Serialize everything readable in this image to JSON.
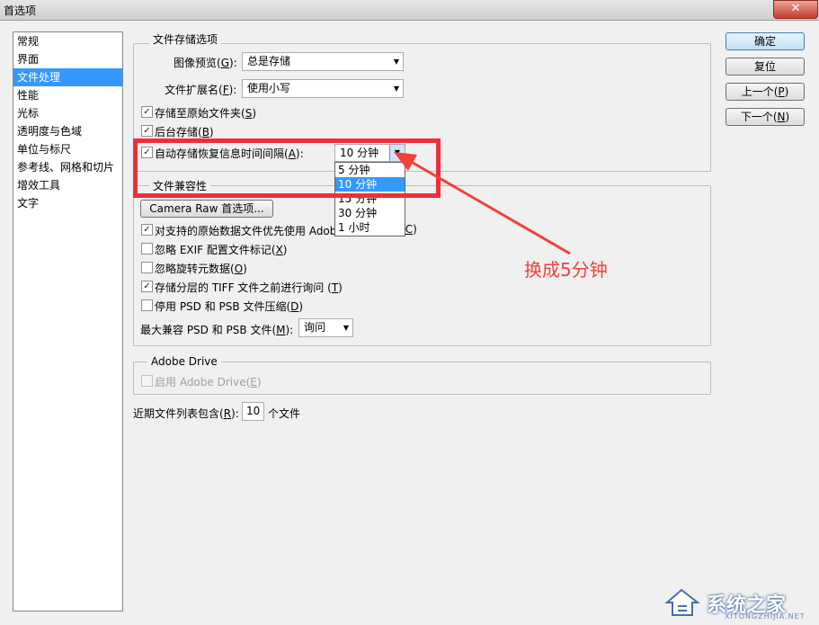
{
  "window": {
    "title": "首选项",
    "close_glyph": "✕"
  },
  "sidebar": {
    "items": [
      {
        "label": "常规"
      },
      {
        "label": "界面"
      },
      {
        "label": "文件处理",
        "selected": true
      },
      {
        "label": "性能"
      },
      {
        "label": "光标"
      },
      {
        "label": "透明度与色域"
      },
      {
        "label": "单位与标尺"
      },
      {
        "label": "参考线、网格和切片"
      },
      {
        "label": "增效工具"
      },
      {
        "label": "文字"
      }
    ]
  },
  "file_saving": {
    "group_title": "文件存储选项",
    "image_preview_label": "图像预览(",
    "image_preview_key": "G",
    "image_preview_value": "总是存储",
    "extension_label": "文件扩展名(",
    "extension_key": "F",
    "extension_value": "使用小写",
    "save_original_label": "存储至原始文件夹(",
    "save_original_key": "S",
    "background_save_label": "后台存储(",
    "background_save_key": "B",
    "autosave_label": "自动存储恢复信息时间间隔(",
    "autosave_key": "A",
    "autosave_value": "10 分钟",
    "autosave_options": [
      "5 分钟",
      "10 分钟",
      "15 分钟",
      "30 分钟",
      "1 小时"
    ],
    "autosave_selected_index": 1
  },
  "compat": {
    "group_title": "文件兼容性",
    "camera_raw_button": "Camera Raw 首选项...",
    "prefer_adobe_label": "对支持的原始数据文件优先使用 Adob",
    "prefer_adobe_key": "C",
    "ignore_exif_label": "忽略 EXIF 配置文件标记(",
    "ignore_exif_key": "X",
    "ignore_rotation_label": "忽略旋转元数据(",
    "ignore_rotation_key": "O",
    "ask_tiff_label": "存储分层的 TIFF 文件之前进行询问 (",
    "ask_tiff_key": "T",
    "disable_psd_label": "停用 PSD 和 PSB 文件压缩(",
    "disable_psd_key": "D",
    "max_compat_label": "最大兼容 PSD 和 PSB 文件(",
    "max_compat_key": "M",
    "max_compat_value": "询问"
  },
  "adobe_drive": {
    "group_title": "Adobe Drive",
    "enable_label": "启用 Adobe Drive(",
    "enable_key": "E"
  },
  "recent": {
    "label_prefix": "近期文件列表包含(",
    "label_key": "R",
    "value": "10",
    "label_suffix": "个文件"
  },
  "buttons": {
    "ok": "确定",
    "reset": "复位",
    "prev": "上一个(",
    "prev_key": "P",
    "next": "下一个(",
    "next_key": "N"
  },
  "annotation": {
    "text": "换成5分钟",
    "color": "#f0413a"
  },
  "watermark": {
    "text": "系统之家",
    "sub": "XITONGZHIJIA.NET"
  },
  "colors": {
    "selection": "#3399ff",
    "highlight": "#ee2f3b"
  }
}
